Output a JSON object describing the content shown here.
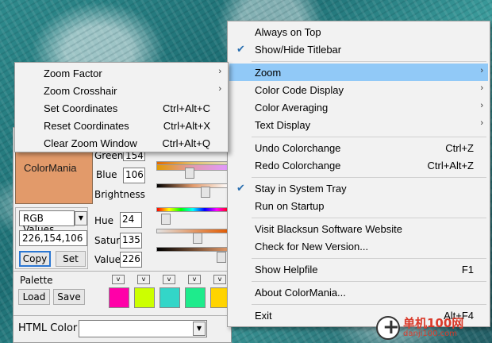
{
  "app": {
    "swatch_label": "ColorMania",
    "swatch_color": "#e29a6a",
    "rgb": {
      "green_label": "Green",
      "green_value": "154",
      "blue_label": "Blue",
      "blue_value": "106",
      "brightness_label": "Brightness"
    },
    "mode": {
      "selected": "RGB Values",
      "value": "226,154,106",
      "copy_label": "Copy",
      "set_label": "Set"
    },
    "hsv": {
      "hue_label": "Hue",
      "hue_value": "24",
      "saturation_label": "Satur.",
      "saturation_value": "135",
      "value_label": "Value",
      "value_value": "226"
    },
    "palette": {
      "title": "Palette",
      "load_label": "Load",
      "save_label": "Save",
      "dropdown_glyph": "v",
      "colors": [
        "#ff00a8",
        "#ccff00",
        "#33d6c8",
        "#1eeb8c",
        "#ffd400"
      ]
    },
    "html_color_label": "HTML Color",
    "html_color_value": ""
  },
  "main_menu": {
    "items": [
      {
        "label": "Always on Top",
        "checked": false
      },
      {
        "label": "Show/Hide Titlebar",
        "checked": true
      },
      {
        "label": "Zoom",
        "submenu": true,
        "highlighted": true
      },
      {
        "label": "Color Code Display",
        "submenu": true
      },
      {
        "label": "Color Averaging",
        "submenu": true
      },
      {
        "label": "Text Display",
        "submenu": true
      },
      {
        "label": "Undo Colorchange",
        "shortcut": "Ctrl+Z"
      },
      {
        "label": "Redo Colorchange",
        "shortcut": "Ctrl+Alt+Z"
      },
      {
        "label": "Stay in System Tray",
        "checked": true
      },
      {
        "label": "Run on Startup"
      },
      {
        "label": "Visit Blacksun Software Website"
      },
      {
        "label": "Check for New Version..."
      },
      {
        "label": "Show Helpfile",
        "shortcut": "F1"
      },
      {
        "label": "About ColorMania..."
      },
      {
        "label": "Exit",
        "shortcut": "Alt+F4"
      }
    ],
    "check_glyph": "✔",
    "arrow_glyph": "›"
  },
  "zoom_submenu": {
    "items": [
      {
        "label": "Zoom Factor",
        "submenu": true
      },
      {
        "label": "Zoom Crosshair",
        "submenu": true
      },
      {
        "label": "Set Coordinates",
        "shortcut": "Ctrl+Alt+C"
      },
      {
        "label": "Reset Coordinates",
        "shortcut": "Ctrl+Alt+X"
      },
      {
        "label": "Clear Zoom Window",
        "shortcut": "Ctrl+Alt+Q"
      }
    ]
  },
  "watermark": {
    "text": "单机100网",
    "url": "danji100.com"
  }
}
